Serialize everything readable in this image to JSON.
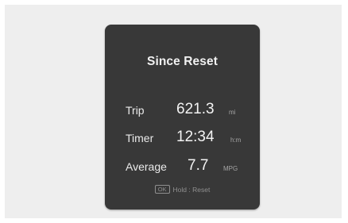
{
  "panel": {
    "title": "Since Reset",
    "rows": [
      {
        "label": "Trip",
        "value": "621.3",
        "unit": "mi"
      },
      {
        "label": "Timer",
        "value": "12:34",
        "unit": "h:m"
      },
      {
        "label": "Average",
        "value": "7.7",
        "unit": "MPG"
      }
    ],
    "hint": {
      "key": "OK",
      "text": "Hold : Reset"
    }
  },
  "colors": {
    "panel_background": "#383838",
    "page_background": "#eeeeee",
    "text_primary": "#f1f1f1",
    "text_secondary": "#a5a5a5"
  }
}
